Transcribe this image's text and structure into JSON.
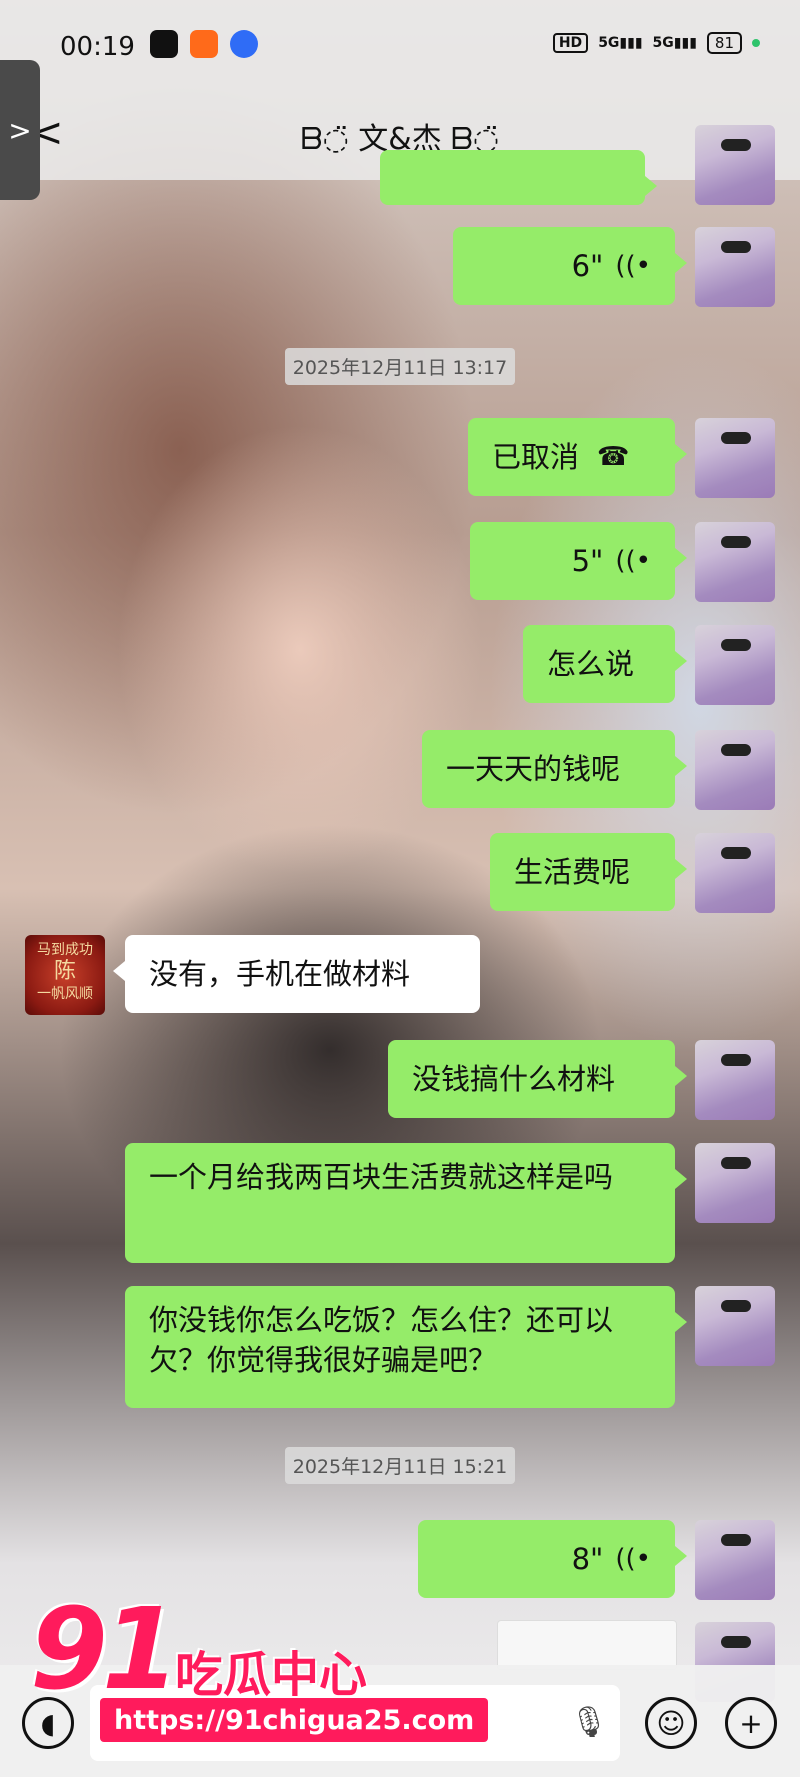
{
  "status_bar": {
    "time": "00:19",
    "hd": "HD",
    "net1": "5G",
    "net2": "5G",
    "battery": "81"
  },
  "nav": {
    "title": "ᗷ◌̈ 文&杰 ᗷ◌̈",
    "more": "···",
    "back": "<",
    "side_tab": ">"
  },
  "messages": [
    {
      "type": "voice",
      "sender": "me",
      "duration": "6\""
    },
    {
      "type": "timestamp",
      "text": "2025年12月11日 13:17"
    },
    {
      "type": "call",
      "sender": "me",
      "text": "已取消"
    },
    {
      "type": "voice",
      "sender": "me",
      "duration": "5\""
    },
    {
      "type": "text",
      "sender": "me",
      "text": "怎么说"
    },
    {
      "type": "text",
      "sender": "me",
      "text": "一天天的钱呢"
    },
    {
      "type": "text",
      "sender": "me",
      "text": "生活费呢"
    },
    {
      "type": "text",
      "sender": "other",
      "text": "没有，手机在做材料"
    },
    {
      "type": "text",
      "sender": "me",
      "text": "没钱搞什么材料"
    },
    {
      "type": "text",
      "sender": "me",
      "text": "一个月给我两百块生活费就这样是吗"
    },
    {
      "type": "text",
      "sender": "me",
      "text": "你没钱你怎么吃饭？怎么住？还可以欠？你觉得我很好骗是吧？"
    },
    {
      "type": "timestamp",
      "text": "2025年12月11日 15:21"
    },
    {
      "type": "voice",
      "sender": "me",
      "duration": "8\""
    }
  ],
  "other_avatar_text": [
    "马到成功",
    "陈",
    "一帆风顺"
  ],
  "watermark": {
    "number": "91",
    "text": "吃瓜中心",
    "url": "https://91chigua25.com"
  },
  "colors": {
    "my_bubble": "#95ec69",
    "other_bubble": "#ffffff",
    "watermark": "#ff1b5c"
  },
  "icons": {
    "voice_wave": "wave-icon",
    "call": "phone-hangup-icon",
    "emoji": "smile-icon",
    "add": "plus-icon",
    "mic": "mic-icon"
  }
}
